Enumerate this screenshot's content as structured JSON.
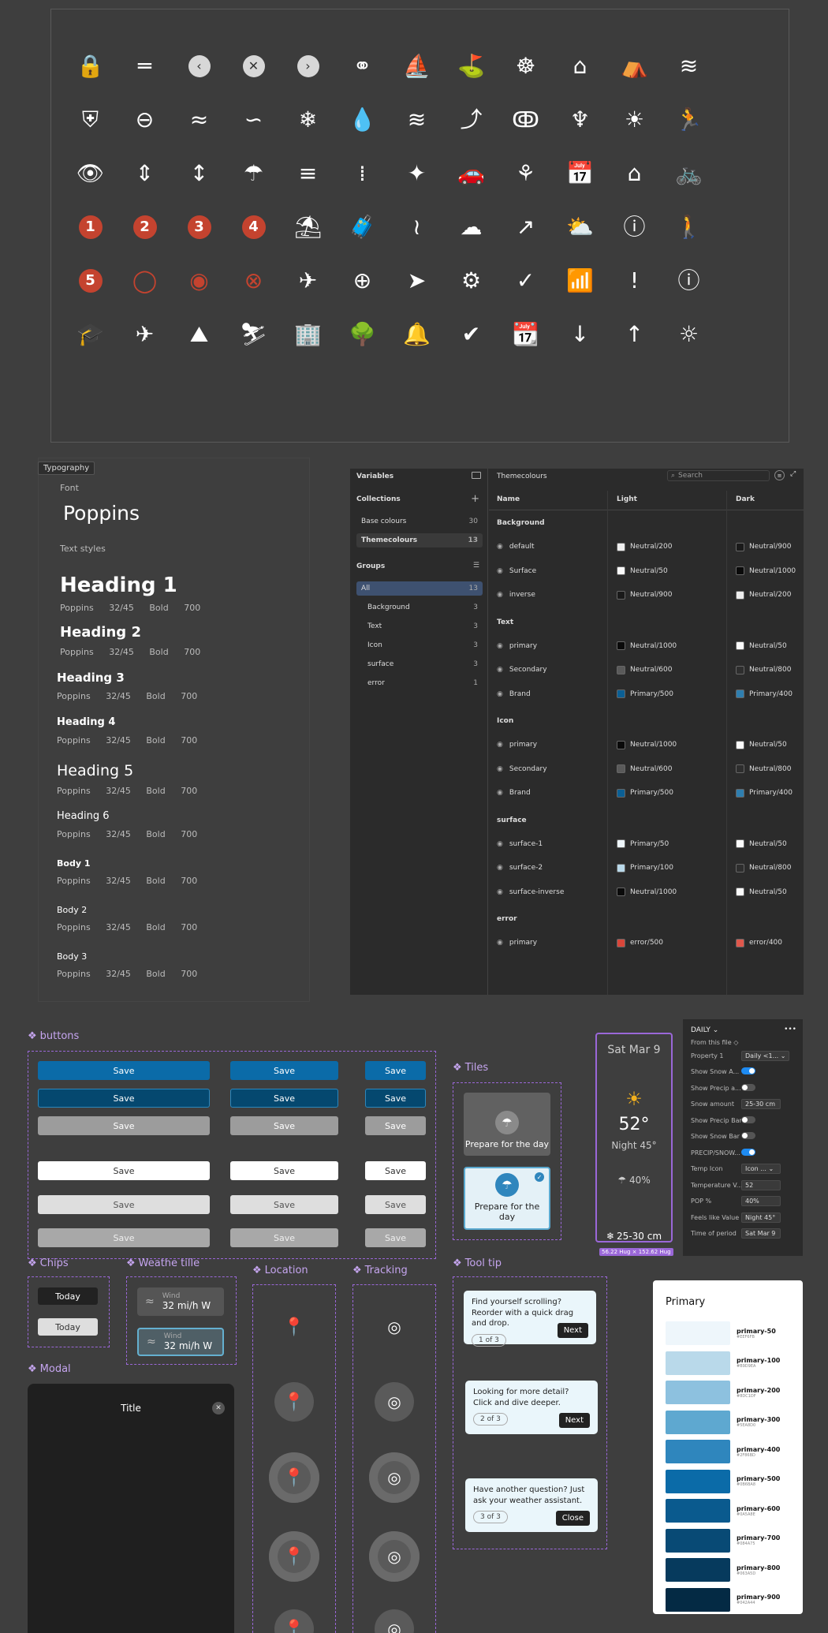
{
  "icons": {
    "rows": [
      [
        {
          "g": "🔒",
          "n": "lock-icon"
        },
        {
          "g": "═",
          "n": "equals-icon"
        },
        {
          "g": "‹",
          "n": "chevron-left-icon",
          "t": "bubble"
        },
        {
          "g": "✕",
          "n": "close-icon",
          "t": "bubble"
        },
        {
          "g": "›",
          "n": "chevron-right-icon",
          "t": "bubble"
        },
        {
          "g": "⚭",
          "n": "binoculars-icon"
        },
        {
          "g": "⛵",
          "n": "sailboat-icon"
        },
        {
          "g": "⛳",
          "n": "golf-icon"
        },
        {
          "g": "☸",
          "n": "ferris-wheel-icon"
        },
        {
          "g": "⌂",
          "n": "home-icon"
        },
        {
          "g": "⛺",
          "n": "tent-icon"
        },
        {
          "g": "≋",
          "n": "waves-icon"
        }
      ],
      [
        {
          "g": "⛨",
          "n": "shield-plus-icon"
        },
        {
          "g": "⊖",
          "n": "minus-circle-icon"
        },
        {
          "g": "≈",
          "n": "wind-icon"
        },
        {
          "g": "∽",
          "n": "breeze-icon"
        },
        {
          "g": "❄",
          "n": "snowflake-icon"
        },
        {
          "g": "💧",
          "n": "drop-icon"
        },
        {
          "g": "≋",
          "n": "water-icon"
        },
        {
          "g": "⤴",
          "n": "stairs-icon"
        },
        {
          "g": "ↂ",
          "n": "head-spiral-icon"
        },
        {
          "g": "♆",
          "n": "sprout-icon"
        },
        {
          "g": "☀",
          "n": "sun-icon"
        },
        {
          "g": "🏃",
          "n": "run-icon"
        }
      ],
      [
        {
          "g": "👁",
          "n": "eye-icon"
        },
        {
          "g": "⇕",
          "n": "compress-icon"
        },
        {
          "g": "↕",
          "n": "arrow-vertical-icon"
        },
        {
          "g": "☂",
          "n": "shower-icon"
        },
        {
          "g": "≡",
          "n": "gust-icon"
        },
        {
          "g": "⁞",
          "n": "dots-grid-icon"
        },
        {
          "g": "✦",
          "n": "sparkle-icon"
        },
        {
          "g": "🚗",
          "n": "car-icon"
        },
        {
          "g": "⚘",
          "n": "plant-icon"
        },
        {
          "g": "📅",
          "n": "calendar-icon"
        },
        {
          "g": "⌂",
          "n": "house-icon"
        },
        {
          "g": "🚲",
          "n": "bike-icon"
        }
      ],
      [
        {
          "g": "1",
          "n": "storm-1-icon",
          "t": "redn"
        },
        {
          "g": "2",
          "n": "storm-2-icon",
          "t": "redn"
        },
        {
          "g": "3",
          "n": "storm-3-icon",
          "t": "redn"
        },
        {
          "g": "4",
          "n": "storm-4-icon",
          "t": "redn"
        },
        {
          "g": "⛱",
          "n": "beach-umbrella-icon"
        },
        {
          "g": "🧳",
          "n": "luggage-icon"
        },
        {
          "g": "≀",
          "n": "humidity-icon"
        },
        {
          "g": "☁",
          "n": "rain-cloud-icon"
        },
        {
          "g": "↗",
          "n": "arrow-up-right-icon"
        },
        {
          "g": "⛅",
          "n": "partly-cloudy-icon"
        },
        {
          "g": "ⓘ",
          "n": "info-outline-icon"
        },
        {
          "g": "🚶",
          "n": "walk-icon"
        }
      ],
      [
        {
          "g": "5",
          "n": "storm-5-icon",
          "t": "redn"
        },
        {
          "g": "◯",
          "n": "hurricane-ring-icon",
          "t": "red"
        },
        {
          "g": "◉",
          "n": "hurricane-icon",
          "t": "red"
        },
        {
          "g": "⊗",
          "n": "hurricane-x-icon",
          "t": "red"
        },
        {
          "g": "✈",
          "n": "departure-icon"
        },
        {
          "g": "⊕",
          "n": "add-circle-icon"
        },
        {
          "g": "➤",
          "n": "navigation-icon"
        },
        {
          "g": "⚙",
          "n": "gear-icon"
        },
        {
          "g": "✓",
          "n": "check-circle-icon"
        },
        {
          "g": "📶",
          "n": "wifi-off-icon"
        },
        {
          "g": "!",
          "n": "alert-icon"
        },
        {
          "g": "ⓘ",
          "n": "info-filled-icon"
        }
      ],
      [
        {
          "g": "🎓",
          "n": "graduation-cap-icon"
        },
        {
          "g": "✈",
          "n": "airplane-icon"
        },
        {
          "g": "⛰",
          "n": "mountain-icon"
        },
        {
          "g": "⛷",
          "n": "ski-icon"
        },
        {
          "g": "🏢",
          "n": "buildings-icon"
        },
        {
          "g": "🌳",
          "n": "park-icon"
        },
        {
          "g": "🔔",
          "n": "bell-icon"
        },
        {
          "g": "✔",
          "n": "verified-badge-icon"
        },
        {
          "g": "📆",
          "n": "calendar-refresh-icon"
        },
        {
          "g": "↓",
          "n": "arrow-down-icon"
        },
        {
          "g": "↑",
          "n": "arrow-up-icon"
        },
        {
          "g": "☼",
          "n": "brightness-icon"
        }
      ]
    ]
  },
  "typography": {
    "tag": "Typography",
    "font_label": "Font",
    "font_name": "Poppins",
    "styles_label": "Text styles",
    "styles": [
      {
        "name": "Heading 1",
        "meta": "Poppins 32/45 Bold 700"
      },
      {
        "name": "Heading 2",
        "meta": "Poppins 32/45 Bold 700"
      },
      {
        "name": "Heading 3",
        "meta": "Poppins 32/45 Bold 700"
      },
      {
        "name": "Heading 4",
        "meta": "Poppins 32/45 Bold 700"
      },
      {
        "name": "Heading 5",
        "meta": "Poppins 32/45 Bold 700"
      },
      {
        "name": "Heading 6",
        "meta": "Poppins 32/45 Bold 700"
      },
      {
        "name": "Body 1",
        "meta": "Poppins 32/45 Bold 700"
      },
      {
        "name": "Body 2",
        "meta": "Poppins 32/45 Bold 700"
      },
      {
        "name": "Body 3",
        "meta": "Poppins 32/45 Bold 700"
      }
    ]
  },
  "variables": {
    "title": "Variables",
    "collections_label": "Collections",
    "collections": [
      {
        "name": "Base colours",
        "count": "30"
      },
      {
        "name": "Themecolours",
        "count": "13"
      }
    ],
    "groups_label": "Groups",
    "groups": [
      {
        "name": "All",
        "count": "13"
      },
      {
        "name": "Background",
        "count": "3"
      },
      {
        "name": "Text",
        "count": "3"
      },
      {
        "name": "Icon",
        "count": "3"
      },
      {
        "name": "surface",
        "count": "3"
      },
      {
        "name": "error",
        "count": "1"
      }
    ],
    "table_title": "Themecolours",
    "search_placeholder": "Search",
    "col_name": "Name",
    "col_light": "Light",
    "col_dark": "Dark",
    "sections": [
      {
        "title": "Background",
        "rows": [
          {
            "name": "default",
            "light": "Neutral/200",
            "lc": "#eeeeee",
            "dark": "Neutral/900",
            "dc": "#1a1a1a"
          },
          {
            "name": "Surface",
            "light": "Neutral/50",
            "lc": "#fafafa",
            "dark": "Neutral/1000",
            "dc": "#0a0a0a"
          },
          {
            "name": "inverse",
            "light": "Neutral/900",
            "lc": "#1a1a1a",
            "dark": "Neutral/200",
            "dc": "#eeeeee"
          }
        ]
      },
      {
        "title": "Text",
        "rows": [
          {
            "name": "primary",
            "light": "Neutral/1000",
            "lc": "#0a0a0a",
            "dark": "Neutral/50",
            "dc": "#fafafa"
          },
          {
            "name": "Secondary",
            "light": "Neutral/600",
            "lc": "#5a5a5a",
            "dark": "Neutral/800",
            "dc": "#2e2e2e"
          },
          {
            "name": "Brand",
            "light": "Primary/500",
            "lc": "#0b5f94",
            "dark": "Primary/400",
            "dc": "#2f7fb0"
          }
        ]
      },
      {
        "title": "Icon",
        "rows": [
          {
            "name": "primary",
            "light": "Neutral/1000",
            "lc": "#0a0a0a",
            "dark": "Neutral/50",
            "dc": "#fafafa"
          },
          {
            "name": "Secondary",
            "light": "Neutral/600",
            "lc": "#5a5a5a",
            "dark": "Neutral/800",
            "dc": "#2e2e2e"
          },
          {
            "name": "Brand",
            "light": "Primary/500",
            "lc": "#0b5f94",
            "dark": "Primary/400",
            "dc": "#2f7fb0"
          }
        ]
      },
      {
        "title": "surface",
        "rows": [
          {
            "name": "surface-1",
            "light": "Primary/50",
            "lc": "#eef6fb",
            "dark": "Neutral/50",
            "dc": "#fafafa"
          },
          {
            "name": "surface-2",
            "light": "Primary/100",
            "lc": "#b9d9ea",
            "dark": "Neutral/800",
            "dc": "#2e2e2e"
          },
          {
            "name": "surface-inverse",
            "light": "Neutral/1000",
            "lc": "#0a0a0a",
            "dark": "Neutral/50",
            "dc": "#fafafa"
          }
        ]
      },
      {
        "title": "error",
        "rows": [
          {
            "name": "primary",
            "light": "error/500",
            "lc": "#d9463a",
            "dark": "error/400",
            "dc": "#e0584c"
          }
        ]
      }
    ]
  },
  "buttons": {
    "label": "buttons",
    "save": "Save"
  },
  "tiles": {
    "label": "Tiles",
    "text": "Prepare for the day"
  },
  "chips": {
    "label": "Chips",
    "text": "Today"
  },
  "weather_tile": {
    "label": "Weathe tille",
    "wind_label": "Wind",
    "wind_value": "32 mi/h W"
  },
  "location": {
    "label": "Location"
  },
  "tracking": {
    "label": "Tracking"
  },
  "tooltip": {
    "label": "Tool tip",
    "items": [
      {
        "text": "Find yourself scrolling? Reorder with a quick drag and drop.",
        "page": "1 of 3",
        "action": "Next"
      },
      {
        "text": "Looking for more detail? Click and dive deeper.",
        "page": "2 of 3",
        "action": "Next"
      },
      {
        "text": "Have another question? Just ask your weather assistant.",
        "page": "3 of 3",
        "action": "Close"
      }
    ]
  },
  "modal": {
    "label": "Modal",
    "title": "Title"
  },
  "daily_card": {
    "date": "Sat Mar 9",
    "temp": "52°",
    "night": "Night 45°",
    "pop": "40%",
    "snow": "25-30 cm",
    "size": "56.22 Hug × 152.62 Hug"
  },
  "daily_panel": {
    "title": "DAILY",
    "from_file": "From this file",
    "rows": [
      {
        "k": "Property 1",
        "v": "Daily <1...",
        "t": "select"
      },
      {
        "k": "Show Snow A...",
        "v": "",
        "t": "on"
      },
      {
        "k": "Show Precip a...",
        "v": "",
        "t": "off"
      },
      {
        "k": "Snow amount",
        "v": "25-30 cm",
        "t": "input"
      },
      {
        "k": "Show Precip Bar",
        "v": "",
        "t": "off"
      },
      {
        "k": "Show Snow Bar",
        "v": "",
        "t": "off"
      },
      {
        "k": "PRECIP/SNOW...",
        "v": "",
        "t": "on"
      },
      {
        "k": "Temp Icon",
        "v": "Icon ...",
        "t": "select"
      },
      {
        "k": "Temperature V...",
        "v": "52",
        "t": "input"
      },
      {
        "k": "POP %",
        "v": "40%",
        "t": "input"
      },
      {
        "k": "Feels like Value",
        "v": "Night 45°",
        "t": "input"
      },
      {
        "k": "Time of period",
        "v": "Sat Mar 9",
        "t": "input"
      }
    ]
  },
  "primary_palette": {
    "title": "Primary",
    "swatches": [
      {
        "name": "primary-50",
        "hex": "#eef6fb",
        "code": "#EEF6FB"
      },
      {
        "name": "primary-100",
        "hex": "#b9d9ea",
        "code": "#B9D9EA"
      },
      {
        "name": "primary-200",
        "hex": "#8dc1df",
        "code": "#8DC1DF"
      },
      {
        "name": "primary-300",
        "hex": "#5ea8d0",
        "code": "#5EA8D0"
      },
      {
        "name": "primary-400",
        "hex": "#2f86bd",
        "code": "#2F86BD"
      },
      {
        "name": "primary-500",
        "hex": "#0b6ba8",
        "code": "#0B6BA8"
      },
      {
        "name": "primary-600",
        "hex": "#0a5a8e",
        "code": "#0A5A8E"
      },
      {
        "name": "primary-700",
        "hex": "#084a75",
        "code": "#084A75"
      },
      {
        "name": "primary-800",
        "hex": "#063a5d",
        "code": "#063A5D"
      },
      {
        "name": "primary-900",
        "hex": "#042a44",
        "code": "#042A44"
      }
    ]
  }
}
